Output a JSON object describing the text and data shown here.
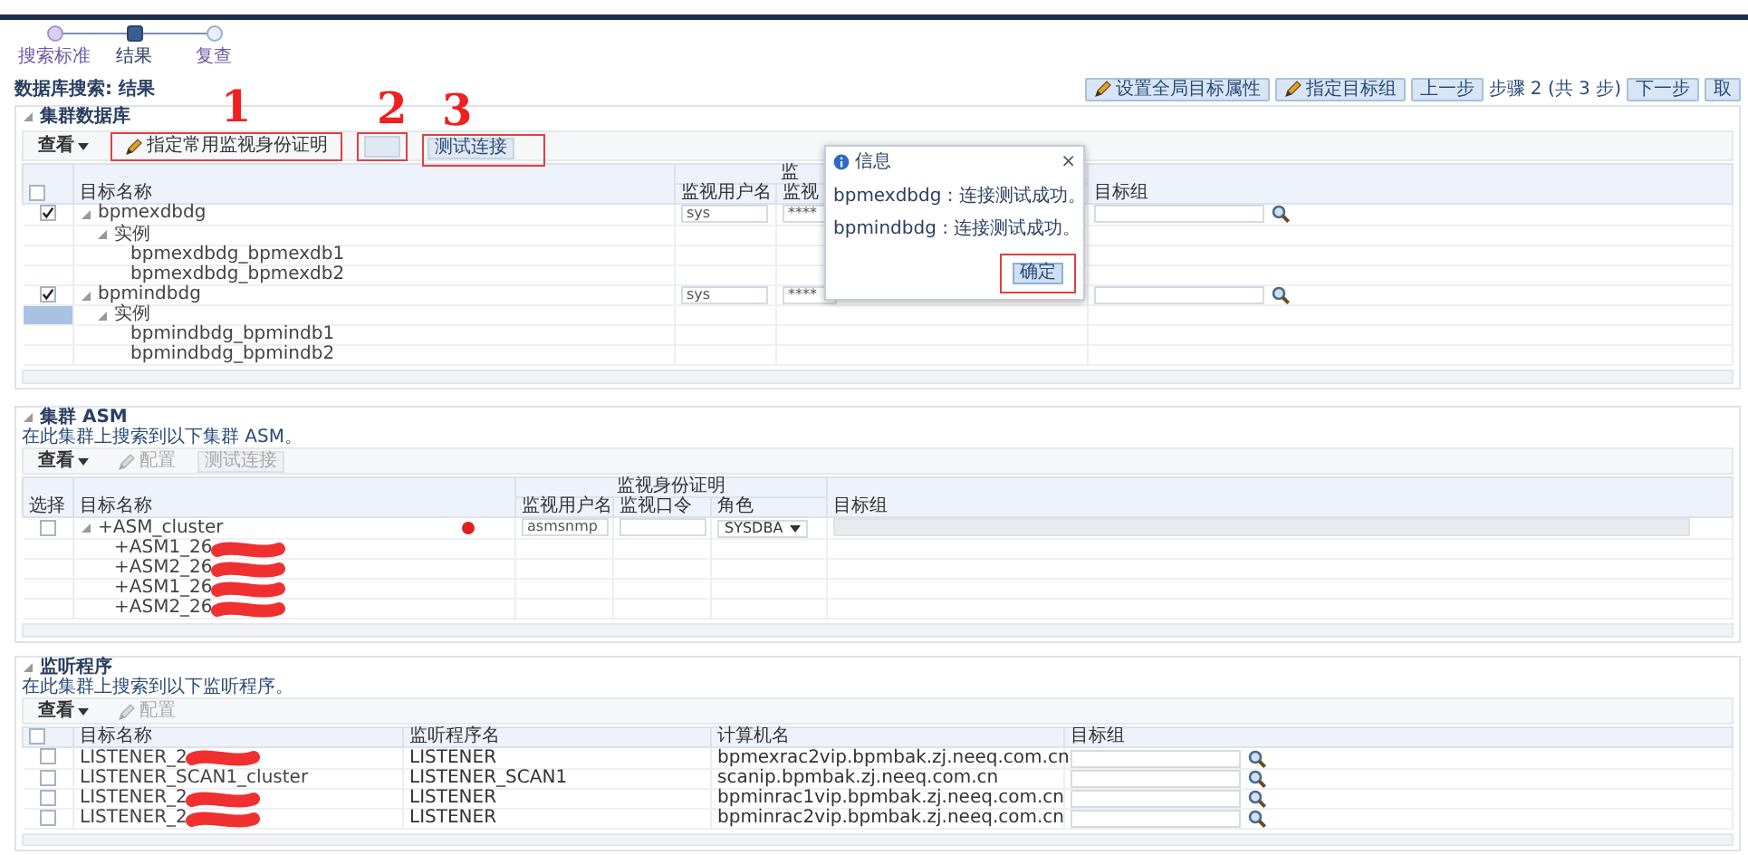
{
  "steps": [
    {
      "label": "搜索标准",
      "selected": false
    },
    {
      "label": "结果",
      "selected": true
    },
    {
      "label": "复查",
      "selected": false
    }
  ],
  "page_title": "数据库搜索: 结果",
  "nav": [
    {
      "label": "设置全局目标属性",
      "kind": "edit"
    },
    {
      "label": "指定目标组",
      "kind": "edit"
    },
    {
      "label": "上一步",
      "kind": "button"
    },
    {
      "label": "步骤 2 (共 3 步)",
      "kind": "text"
    },
    {
      "label": "下一步",
      "kind": "button"
    },
    {
      "label": "取",
      "kind": "button"
    }
  ],
  "cluster_databases": {
    "title": "集群数据库",
    "expanded": true,
    "toolbar": [
      {
        "kind": "menu",
        "label": "查看",
        "disabled": false
      },
      {
        "kind": "edit",
        "label": "指定常用监视身份证明",
        "disabled": false,
        "annotation": "1"
      },
      {
        "kind": "blank",
        "disabled": false,
        "annotation": "2"
      },
      {
        "kind": "plain",
        "label": "测试连接",
        "disabled": false,
        "annotation": "3"
      }
    ],
    "select_all_checked": false,
    "columns": {
      "target_name": "目标名称",
      "credentials_group": "监",
      "user": "监视用户名",
      "password": "监视",
      "target_group": "目标组"
    },
    "rows": [
      {
        "name": "bpmexdbdg",
        "checked": true,
        "selected": false,
        "expanded": true,
        "user": "sys",
        "password": "****",
        "children": [
          {
            "name": "实例",
            "selected": false,
            "expanded": true,
            "children": [
              {
                "name": "bpmexdbdg_bpmexdb1",
                "selected": false
              },
              {
                "name": "bpmexdbdg_bpmexdb2",
                "selected": false
              }
            ]
          }
        ]
      },
      {
        "name": "bpmindbdg",
        "checked": true,
        "selected": false,
        "expanded": true,
        "user": "sys",
        "password": "****",
        "children": [
          {
            "name": "实例",
            "selected": true,
            "expanded": true,
            "children": [
              {
                "name": "bpmindbdg_bpmindb1",
                "selected": false
              },
              {
                "name": "bpmindbdg_bpmindb2",
                "selected": false
              }
            ]
          }
        ]
      }
    ],
    "dialog": {
      "title": "信息",
      "close": "×",
      "messages": [
        "bpmexdbdg : 连接测试成功。",
        "bpmindbdg : 连接测试成功。"
      ],
      "ok": "确定",
      "ok_annotated": true
    }
  },
  "asm": {
    "title": "集群 ASM",
    "expanded": true,
    "description": "在此集群上搜索到以下集群 ASM。",
    "toolbar": [
      {
        "kind": "menu",
        "label": "查看",
        "disabled": false
      },
      {
        "kind": "config",
        "label": "配置",
        "disabled": true
      },
      {
        "kind": "plain",
        "label": "测试连接",
        "disabled": true
      }
    ],
    "columns": {
      "select": "选择",
      "target_name": "目标名称",
      "credentials_group": "监视身份证明",
      "user": "监视用户名",
      "password": "监视口令",
      "role": "角色",
      "target_group": "目标组"
    },
    "rows": [
      {
        "name": "+ASM_cluster",
        "checked": false,
        "expanded": true,
        "annotation_dot": true,
        "user": "asmsnmp",
        "role": "SYSDBA",
        "children": [
          {
            "name": "+ASM1_26",
            "redacted": true
          },
          {
            "name": "+ASM2_26",
            "redacted": true
          },
          {
            "name": "+ASM1_26",
            "redacted": true
          },
          {
            "name": "+ASM2_26",
            "redacted": true
          }
        ]
      }
    ]
  },
  "listeners": {
    "title": "监听程序",
    "expanded": true,
    "description": "在此集群上搜索到以下监听程序。",
    "toolbar": [
      {
        "kind": "menu",
        "label": "查看",
        "disabled": false
      },
      {
        "kind": "config",
        "label": "配置",
        "disabled": true
      }
    ],
    "select_all_checked": false,
    "columns": {
      "target_name": "目标名称",
      "listener_name": "监听程序名",
      "host": "计算机名",
      "target_group": "目标组"
    },
    "rows": [
      {
        "name": "LISTENER_2",
        "redacted": true,
        "checked": false,
        "listener": "LISTENER",
        "host": "bpmexrac2vip.bpmbak.zj.neeq.com.cn"
      },
      {
        "name": "LISTENER_SCAN1_cluster",
        "redacted": false,
        "checked": false,
        "listener": "LISTENER_SCAN1",
        "host": "scanip.bpmbak.zj.neeq.com.cn"
      },
      {
        "name": "LISTENER_2",
        "redacted": true,
        "checked": false,
        "listener": "LISTENER",
        "host": "bpminrac1vip.bpmbak.zj.neeq.com.cn"
      },
      {
        "name": "LISTENER_2",
        "redacted": true,
        "checked": false,
        "listener": "LISTENER",
        "host": "bpminrac2vip.bpmbak.zj.neeq.com.cn"
      }
    ]
  }
}
